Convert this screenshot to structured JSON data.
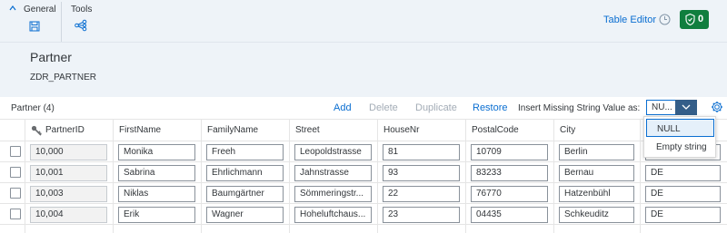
{
  "toolbar": {
    "groups": [
      {
        "label": "General",
        "icon": "save-icon"
      },
      {
        "label": "Tools",
        "icon": "share-network-icon"
      }
    ],
    "table_editor_label": "Table Editor",
    "badge_count": "0",
    "colors": {
      "accent": "#0a6ed1",
      "badge": "#107e3e",
      "header_bg": "#eef3f8"
    }
  },
  "header": {
    "title": "Partner",
    "subtitle": "ZDR_PARTNER"
  },
  "table_toolbar": {
    "title": "Partner (4)",
    "add": "Add",
    "delete": "Delete",
    "duplicate": "Duplicate",
    "restore": "Restore",
    "insert_label": "Insert Missing String Value as:",
    "select_value": "NU...",
    "options": [
      "NULL",
      "Empty string"
    ]
  },
  "table": {
    "columns": [
      "PartnerID",
      "FirstName",
      "FamilyName",
      "Street",
      "HouseNr",
      "PostalCode",
      "City"
    ],
    "rows": [
      {
        "id": "10,000",
        "first": "Monika",
        "family": "Freeh",
        "street": "Leopoldstrasse",
        "house": "81",
        "postal": "10709",
        "city": "Berlin",
        "country": ""
      },
      {
        "id": "10,001",
        "first": "Sabrina",
        "family": "Ehrlichmann",
        "street": "Jahnstrasse",
        "house": "93",
        "postal": "83233",
        "city": "Bernau",
        "country": "DE"
      },
      {
        "id": "10,003",
        "first": "Niklas",
        "family": "Baumgärtner",
        "street": "Sömmeringstr...",
        "house": "22",
        "postal": "76770",
        "city": "Hatzenbühl",
        "country": "DE"
      },
      {
        "id": "10,004",
        "first": "Erik",
        "family": "Wagner",
        "street": "Hoheluftchaus...",
        "house": "23",
        "postal": "04435",
        "city": "Schkeuditz",
        "country": "DE"
      }
    ]
  }
}
